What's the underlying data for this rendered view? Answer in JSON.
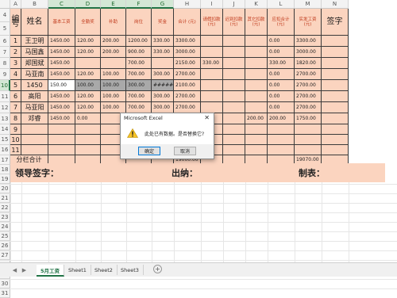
{
  "columns": [
    "A",
    "B",
    "C",
    "D",
    "E",
    "F",
    "G",
    "H",
    "I",
    "J",
    "K",
    "L",
    "M",
    "N"
  ],
  "selected_columns": [
    "C",
    "D",
    "E",
    "F",
    "G"
  ],
  "rows": [
    "4",
    "5",
    "6",
    "7",
    "8",
    "9",
    "10",
    "11",
    "12",
    "13",
    "14",
    "15",
    "16",
    "17",
    "18",
    "19",
    "20",
    "21",
    "22",
    "23",
    "24",
    "25",
    "26",
    "27",
    "28",
    "29",
    "30",
    "31"
  ],
  "selected_row": "10",
  "header": {
    "no": "编号",
    "name": "姓名",
    "base": "基本工资",
    "attend": "全勤奖",
    "subsidy": "补助",
    "post": "岗位",
    "bonus": "奖金",
    "total": "合计\n(元)",
    "leave": "请假扣款\n(元)",
    "late": "迟到扣款(元)",
    "other": "其它扣款(元)",
    "deduct_total": "应扣合计(元)",
    "actual": "实发工资\n(元)",
    "sign": "签字"
  },
  "data_rows": [
    {
      "no": "1",
      "name": "王卫明",
      "base": "1450.00",
      "attend": "120.00",
      "subsidy": "200.00",
      "post": "1200.00",
      "bonus": "330.00",
      "total": "3300.00",
      "leave": "",
      "late": "",
      "other": "",
      "deduct": "0.00",
      "actual": "3300.00"
    },
    {
      "no": "2",
      "name": "马国鑫",
      "base": "1450.00",
      "attend": "120.00",
      "subsidy": "200.00",
      "post": "900.00",
      "bonus": "330.00",
      "total": "3000.00",
      "leave": "",
      "late": "",
      "other": "",
      "deduct": "0.00",
      "actual": "3000.00"
    },
    {
      "no": "3",
      "name": "郑国斌",
      "base": "1450.00",
      "attend": "",
      "subsidy": "",
      "post": "700.00",
      "bonus": "",
      "total": "2150.00",
      "leave": "330.00",
      "late": "",
      "other": "",
      "deduct": "330.00",
      "actual": "1820.00"
    },
    {
      "no": "4",
      "name": "马亚南",
      "base": "1450.00",
      "attend": "120.00",
      "subsidy": "100.00",
      "post": "700.00",
      "bonus": "300.00",
      "total": "2700.00",
      "leave": "",
      "late": "",
      "other": "",
      "deduct": "0.00",
      "actual": "2700.00"
    },
    {
      "no": "5",
      "name": "1450",
      "base": "150.00",
      "attend": "100.00",
      "subsidy": "100.00",
      "post": "300.00",
      "bonus": "#######",
      "total": "2100.00",
      "leave": "",
      "late": "",
      "other": "",
      "deduct": "0.00",
      "actual": "2700.00"
    },
    {
      "no": "6",
      "name": "高阳",
      "base": "1450.00",
      "attend": "120.00",
      "subsidy": "100.00",
      "post": "700.00",
      "bonus": "300.00",
      "total": "2700.00",
      "leave": "",
      "late": "",
      "other": "",
      "deduct": "0.00",
      "actual": "2700.00"
    },
    {
      "no": "7",
      "name": "马亚阳",
      "base": "1450.00",
      "attend": "120.00",
      "subsidy": "100.00",
      "post": "700.00",
      "bonus": "300.00",
      "total": "2700.00",
      "leave": "",
      "late": "",
      "other": "",
      "deduct": "0.00",
      "actual": "2700.00"
    },
    {
      "no": "8",
      "name": "邓睿",
      "base": "1450.00",
      "attend": "0.00",
      "subsidy": "",
      "post": "",
      "bonus": "",
      "total": "",
      "leave": "",
      "late": "",
      "other": "200.00",
      "deduct": "200.00",
      "actual": "1750.00"
    },
    {
      "no": "9",
      "name": "",
      "base": "",
      "attend": "",
      "subsidy": "",
      "post": "",
      "bonus": "",
      "total": "",
      "leave": "",
      "late": "",
      "other": "",
      "deduct": "",
      "actual": ""
    },
    {
      "no": "10",
      "name": "",
      "base": "",
      "attend": "",
      "subsidy": "",
      "post": "",
      "bonus": "",
      "total": "",
      "leave": "",
      "late": "",
      "other": "",
      "deduct": "",
      "actual": ""
    },
    {
      "no": "11",
      "name": "",
      "base": "",
      "attend": "",
      "subsidy": "",
      "post": "",
      "bonus": "",
      "total": "",
      "leave": "",
      "late": "",
      "other": "",
      "deduct": "",
      "actual": ""
    }
  ],
  "subtotal": {
    "label": "分栏合计",
    "total": "19000.00",
    "actual": "19070.00"
  },
  "footer": {
    "leader": "领导签字：",
    "cashier": "出纳：",
    "preparer": "制表："
  },
  "sheets": [
    "5月工资",
    "Sheet1",
    "Sheet2",
    "Sheet3"
  ],
  "active_sheet": "5月工资",
  "add_sheet": "+",
  "dialog": {
    "title": "Microsoft Excel",
    "close": "✕",
    "message": "此处已有数据。是否替换它?",
    "ok": "确定",
    "cancel": "取消"
  },
  "colors": {
    "accent": "#217346",
    "row_fill": "#fbd4bf",
    "header_red": "#c0391b"
  }
}
